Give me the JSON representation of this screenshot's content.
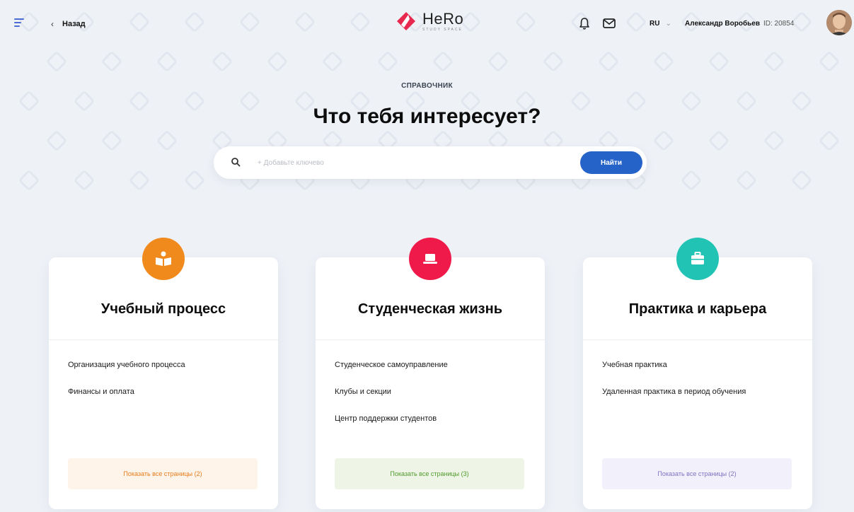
{
  "header": {
    "back_label": "Назад",
    "logo": {
      "brand": "HeRo",
      "sub": "STUDY SPACE"
    },
    "lang": "RU",
    "user": {
      "name": "Александр Воробьев",
      "id": "ID: 20854"
    }
  },
  "hero": {
    "eyebrow": "СПРАВОЧНИК",
    "title": "Что тебя интересует?"
  },
  "search": {
    "placeholder": "+ Добавьте ключево",
    "button_label": "Найти"
  },
  "cards": [
    {
      "title": "Учебный процесс",
      "icon": "book-reader-icon",
      "color": "#f08a1c",
      "links": [
        "Организация учебного процесса",
        "Финансы и оплата"
      ],
      "show_all": "Показать все страницы (2)",
      "show_bg": "#fff4ea",
      "show_color": "#e57c1a"
    },
    {
      "title": "Студенческая жизнь",
      "icon": "laptop-icon",
      "color": "#ef1a4a",
      "links": [
        "Студенческое самоуправление",
        "Клубы и секции",
        "Центр поддержки студентов"
      ],
      "show_all": "Показать все страницы (3)",
      "show_bg": "#eef5e6",
      "show_color": "#4f9a2b"
    },
    {
      "title": "Практика и карьера",
      "icon": "briefcase-icon",
      "color": "#21c4b4",
      "links": [
        "Учебная практика",
        "Удаленная практика в период обучения"
      ],
      "show_all": "Показать все страницы (2)",
      "show_bg": "#f2f0fb",
      "show_color": "#7d74c2"
    }
  ]
}
